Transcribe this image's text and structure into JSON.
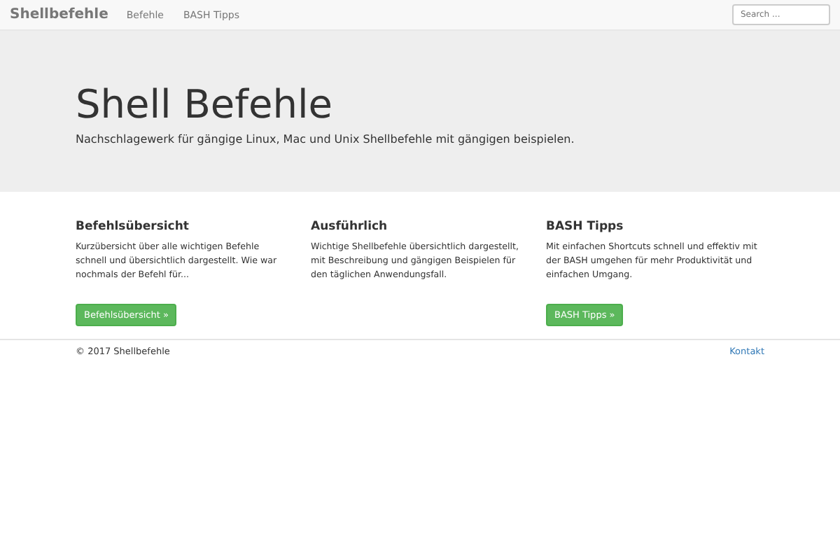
{
  "navbar": {
    "brand": "Shellbefehle",
    "links": [
      {
        "label": "Befehle"
      },
      {
        "label": "BASH Tipps"
      }
    ],
    "search": {
      "placeholder": "Search ..."
    }
  },
  "hero": {
    "title": "Shell Befehle",
    "subtitle": "Nachschlagewerk für gängige Linux, Mac und Unix Shellbefehle mit gängigen beispielen."
  },
  "columns": [
    {
      "heading": "Befehlsübersicht",
      "text": "Kurzübersicht über alle wichtigen Befehle schnell und übersichtlich dargestellt. Wie war nochmals der Befehl für...",
      "button": "Befehlsübersicht »"
    },
    {
      "heading": "Ausführlich",
      "text": "Wichtige Shellbefehle übersichtlich dargestellt, mit Beschreibung und gängigen Beispielen für den täglichen Anwendungsfall."
    },
    {
      "heading": "BASH Tipps",
      "text": "Mit einfachen Shortcuts schnell und effektiv mit der BASH umgehen für mehr Produktivität und einfachen Umgang.",
      "button": "BASH Tipps »"
    }
  ],
  "footer": {
    "copyright": "© 2017 Shellbefehle",
    "link": "Kontakt"
  }
}
